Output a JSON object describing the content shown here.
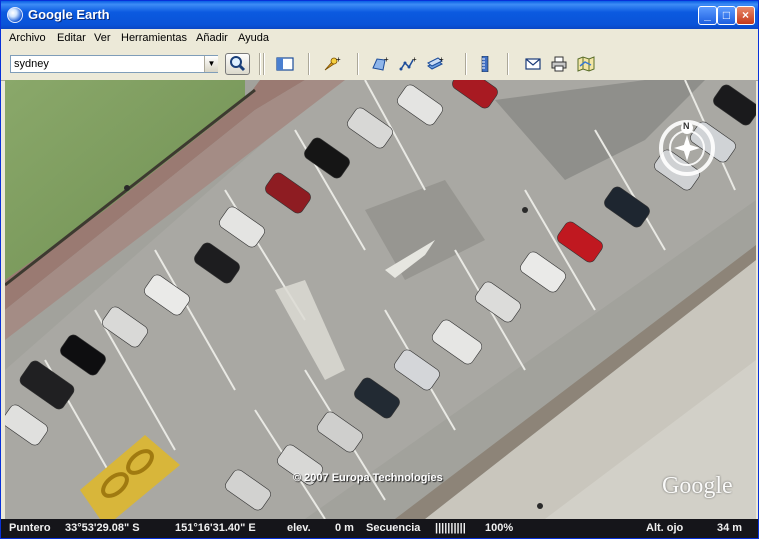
{
  "window": {
    "title": "Google Earth"
  },
  "menu": [
    "Archivo",
    "Editar",
    "Ver",
    "Herramientas",
    "Añadir",
    "Ayuda"
  ],
  "search": {
    "value": "sydney"
  },
  "toolbar": {
    "tools": [
      "sidebar-toggle-icon",
      "add-placemark-icon",
      "add-polygon-icon",
      "add-path-icon",
      "add-image-overlay-icon",
      "ruler-icon",
      "email-icon",
      "print-icon",
      "google-maps-icon"
    ]
  },
  "map": {
    "copyright": "© 2007 Europa Technologies",
    "watermark": "Google",
    "compass_north": "N"
  },
  "status": {
    "pointer_label": "Puntero",
    "latitude": "33°53'29.08\" S",
    "longitude": "151°16'31.40\" E",
    "elev_label": "elev.",
    "elev_value": "0 m",
    "stream_label": "Secuencia",
    "stream_bar": "||||||||||",
    "stream_percent": "100%",
    "eye_alt_label": "Alt. ojo",
    "eye_alt_value": "34 m"
  },
  "colors": {
    "titlebar": "#0a5fe4",
    "statusbar": "#15151a",
    "grass": "#7a9c5a",
    "car_red": "#c01820"
  }
}
